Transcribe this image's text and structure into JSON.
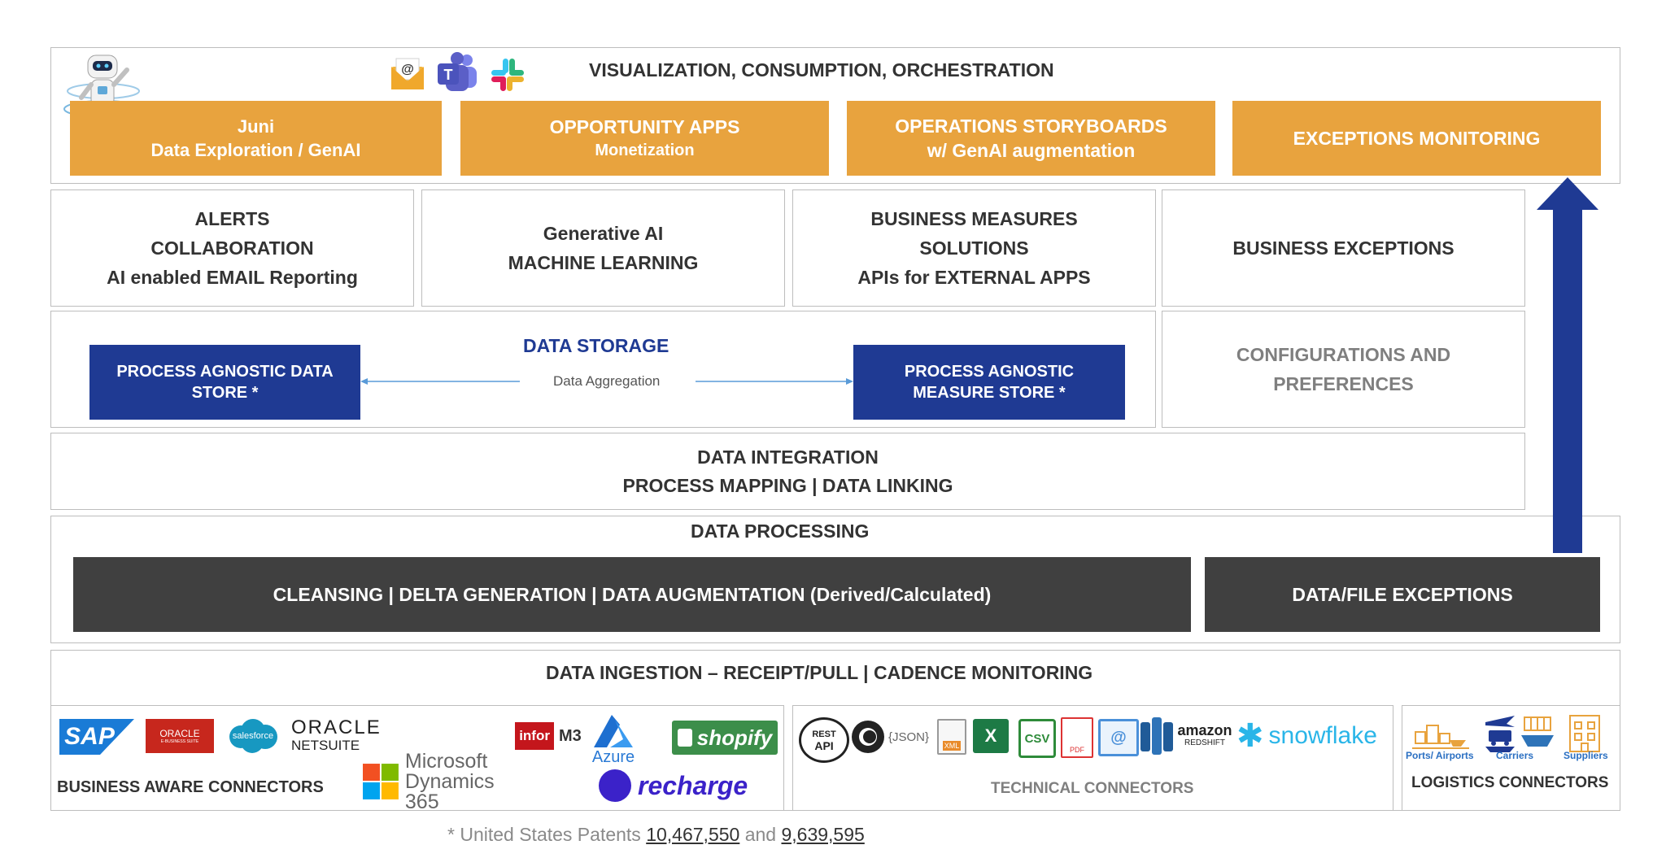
{
  "top": {
    "title": "VISUALIZATION, CONSUMPTION, ORCHESTRATION",
    "cards": [
      {
        "line1": "Juni",
        "line2": "Data Exploration / GenAI"
      },
      {
        "line1": "OPPORTUNITY APPS",
        "line2": "Monetization"
      },
      {
        "line1": "OPERATIONS STORYBOARDS",
        "line2": "w/ GenAI augmentation"
      },
      {
        "line1": "EXCEPTIONS MONITORING",
        "line2": ""
      }
    ],
    "icons": [
      "robot-icon",
      "email-icon",
      "teams-icon",
      "slack-icon"
    ]
  },
  "services": [
    {
      "lines": [
        "ALERTS",
        "COLLABORATION",
        "AI enabled EMAIL Reporting"
      ]
    },
    {
      "lines": [
        "Generative AI",
        "MACHINE LEARNING"
      ]
    },
    {
      "lines": [
        "BUSINESS MEASURES",
        "SOLUTIONS",
        "APIs for EXTERNAL APPS"
      ]
    },
    {
      "lines": [
        "BUSINESS EXCEPTIONS"
      ]
    }
  ],
  "storage": {
    "title": "DATA STORAGE",
    "left_store": [
      "PROCESS AGNOSTIC DATA",
      "STORE *"
    ],
    "right_store": [
      "PROCESS AGNOSTIC",
      "MEASURE STORE *"
    ],
    "aggregation": "Data Aggregation",
    "config": [
      "CONFIGURATIONS AND",
      "PREFERENCES"
    ]
  },
  "integration": {
    "line1": "DATA INTEGRATION",
    "line2": "PROCESS MAPPING | DATA LINKING"
  },
  "processing": {
    "title": "DATA PROCESSING",
    "main": "CLEANSING | DELTA GENERATION | DATA AUGMENTATION (Derived/Calculated)",
    "exceptions": "DATA/FILE EXCEPTIONS"
  },
  "ingestion": {
    "title": "DATA INGESTION – RECEIPT/PULL | CADENCE MONITORING",
    "business_label": "BUSINESS AWARE CONNECTORS",
    "technical_label": "TECHNICAL CONNECTORS",
    "logistics_label": "LOGISTICS CONNECTORS",
    "business_logos": {
      "sap": "SAP",
      "oracle_ebs_1": "ORACLE",
      "oracle_ebs_2": "E-BUSINESS SUITE",
      "salesforce": "salesforce",
      "oracle_netsuite_1": "ORACLE",
      "oracle_netsuite_2": "NETSUITE",
      "infor": "infor",
      "m3": "M3",
      "azure": "Azure",
      "shopify": "shopify",
      "ms_1": "Microsoft",
      "ms_2": "Dynamics 365",
      "recharge": "recharge"
    },
    "technical_logos": {
      "rest_1": "REST",
      "rest_2": "API",
      "json": "{JSON}",
      "xml": "XML",
      "excel": "X",
      "csv": "CSV",
      "pdf": "PDF",
      "email": "@",
      "amazon_1": "amazon",
      "amazon_2": "REDSHIFT",
      "snowflake": "snowflake"
    },
    "logistics": [
      {
        "label": "Ports/ Airports",
        "icon": "port-icon"
      },
      {
        "label": "Carriers",
        "icon": "carrier-icon"
      },
      {
        "label": "Suppliers",
        "icon": "supplier-icon"
      }
    ]
  },
  "footer": {
    "prefix": "* United States Patents",
    "patent1": "10,467,550",
    "and": "and",
    "patent2": "9,639,595"
  },
  "colors": {
    "orange": "#e8a33e",
    "navy": "#1f3a93",
    "dark": "#404040",
    "arrow": "#1f3a93"
  }
}
